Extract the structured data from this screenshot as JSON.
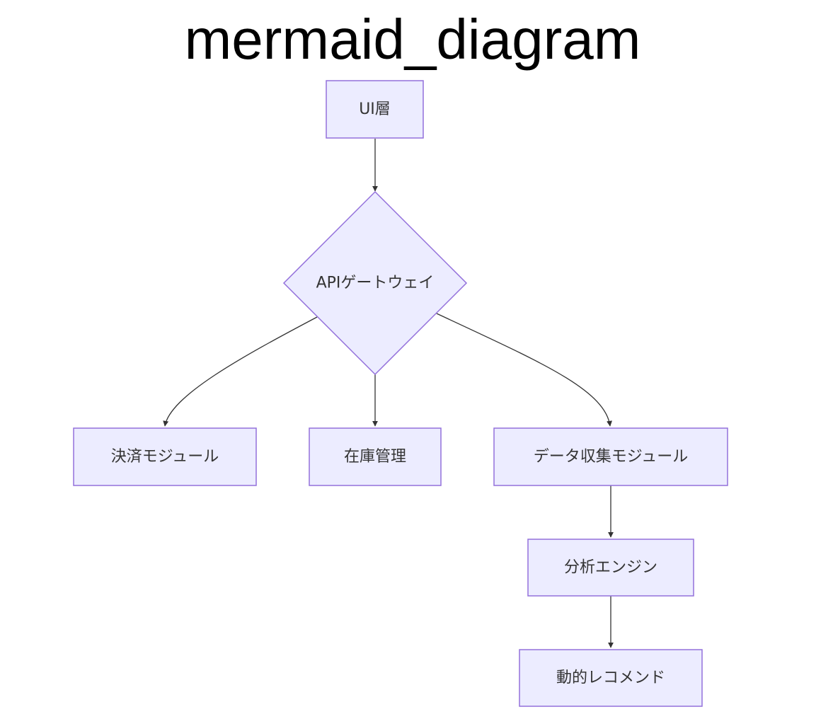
{
  "title": "mermaid_diagram",
  "colors": {
    "node_fill": "#ececff",
    "node_stroke": "#9370db",
    "edge": "#333333",
    "text": "#333333"
  },
  "nodes": {
    "ui": "UI層",
    "api": "APIゲートウェイ",
    "payment": "決済モジュール",
    "inventory": "在庫管理",
    "data_collect": "データ収集モジュール",
    "analytics": "分析エンジン",
    "recommend": "動的レコメンド"
  },
  "edges": [
    {
      "from": "ui",
      "to": "api"
    },
    {
      "from": "api",
      "to": "payment"
    },
    {
      "from": "api",
      "to": "inventory"
    },
    {
      "from": "api",
      "to": "data_collect"
    },
    {
      "from": "data_collect",
      "to": "analytics"
    },
    {
      "from": "analytics",
      "to": "recommend"
    }
  ]
}
